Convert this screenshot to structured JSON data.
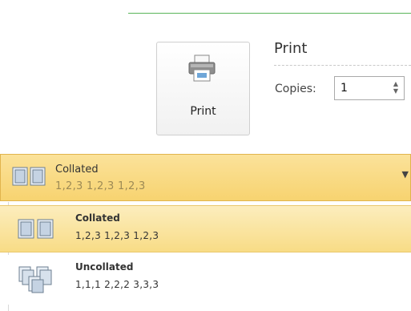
{
  "print_button": {
    "label": "Print",
    "icon": "printer-icon"
  },
  "section": {
    "title": "Print"
  },
  "copies": {
    "label": "Copies:",
    "value": "1"
  },
  "dropdown": {
    "selected_title": "Collated",
    "selected_sequence": "1,2,3   1,2,3   1,2,3",
    "icon": "collated-icon"
  },
  "options": [
    {
      "name": "Collated",
      "sequence": "1,2,3   1,2,3   1,2,3",
      "icon": "collated-icon",
      "selected": true
    },
    {
      "name": "Uncollated",
      "sequence": "1,1,1   2,2,2   3,3,3",
      "icon": "uncollated-icon",
      "selected": false
    }
  ],
  "colors": {
    "accent_green": "#5ab55a",
    "highlight": "#f7d370",
    "highlight_border": "#e1b44d"
  }
}
